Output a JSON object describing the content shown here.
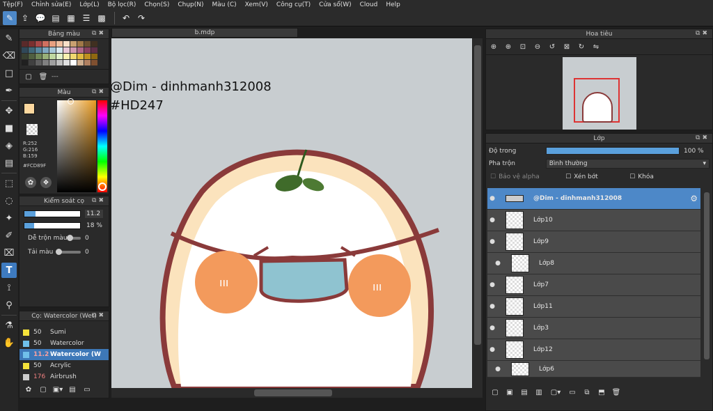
{
  "menu": [
    "Tệp(F)",
    "Chỉnh sửa(E)",
    "Lớp(L)",
    "Bộ lọc(R)",
    "Chọn(S)",
    "Chụp(N)",
    "Màu (C)",
    "Xem(V)",
    "Công cụ(T)",
    "Cửa sổ(W)",
    "Cloud",
    "Help"
  ],
  "canvas": {
    "tab_title": "b.mdp",
    "text_line1": "@Dim - dinhmanh312008",
    "text_line2": "#HD247",
    "mask_color": "#8fc3d0",
    "outline_color": "#8a3a3a"
  },
  "palette": {
    "title": "Bảng màu",
    "footer_text": "---",
    "swatches": [
      "#5a2a2a",
      "#7a3030",
      "#a84848",
      "#d07060",
      "#e8a080",
      "#f0c0a0",
      "#f8e0c8",
      "#c8a070",
      "#a07848",
      "#6c5030",
      "#403020",
      "#304858",
      "#406878",
      "#5888a0",
      "#80a8c0",
      "#a8c8d8",
      "#d8e8f0",
      "#e8c8d8",
      "#d098b0",
      "#b06888",
      "#884060",
      "#603048",
      "#384030",
      "#506040",
      "#708858",
      "#98b078",
      "#c0d8a0",
      "#e0f0c8",
      "#f8f0b0",
      "#f0d870",
      "#e0b840",
      "#c09020",
      "#906810",
      "#202020",
      "#404040",
      "#606060",
      "#808080",
      "#a0a0a0",
      "#c0c0c0",
      "#e0e0e0",
      "#ffffff",
      "#d0b090",
      "#b08060",
      "#805030"
    ]
  },
  "color": {
    "title": "Màu",
    "r": "R:252",
    "g": "G:216",
    "b": "B:159",
    "hex": "#FCD89F",
    "fg": "#FCD89F",
    "bg": "#ffffff"
  },
  "brush_control": {
    "title": "Kiểm soát cọ",
    "size_value": "11.2",
    "opacity_value": "18 %",
    "blend_label": "Dễ trộn màu",
    "blend_value": "0",
    "reload_label": "Tải màu",
    "reload_value": "0"
  },
  "brushes": {
    "title": "Cọ: Watercolor (Wet)",
    "items": [
      {
        "num": "50",
        "name": "Sumi",
        "color": "#f5e23a"
      },
      {
        "num": "50",
        "name": "Watercolor",
        "color": "#70c0ea"
      },
      {
        "num": "11.2",
        "name": "Watercolor (W",
        "color": "#70c0ea",
        "selected": true
      },
      {
        "num": "50",
        "name": "Acrylic",
        "color": "#f5e23a"
      },
      {
        "num": "176",
        "name": "Airbrush",
        "color": "#cccccc"
      }
    ]
  },
  "navigator": {
    "title": "Hoa tiêu"
  },
  "layers": {
    "title": "Lớp",
    "opacity_label": "Độ trong",
    "opacity_value": "100 %",
    "opacity_fraction": 1.0,
    "blend_label": "Pha trộn",
    "blend_value": "Bình thường",
    "protect_alpha": "Bảo vệ alpha",
    "clipping": "Xén bớt",
    "lock": "Khóa",
    "items": [
      {
        "name": "@Dim - dinhmanh312008",
        "selected": true
      },
      {
        "name": "Lớp10"
      },
      {
        "name": "Lớp9"
      },
      {
        "name": "Lớp8"
      },
      {
        "name": "Lớp7"
      },
      {
        "name": "Lớp11"
      },
      {
        "name": "Lớp3"
      },
      {
        "name": "Lớp12"
      },
      {
        "name": "Lớp6"
      }
    ]
  }
}
